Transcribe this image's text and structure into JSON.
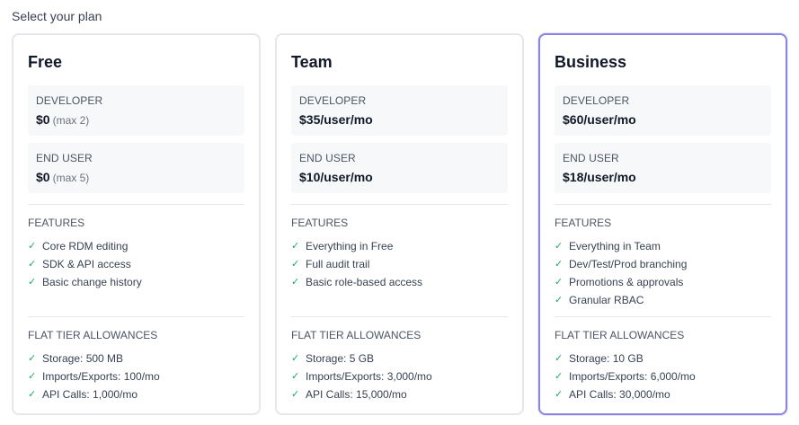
{
  "page": {
    "heading": "Select your plan"
  },
  "plans": [
    {
      "name": "Free",
      "selected": false,
      "developer": {
        "label": "DEVELOPER",
        "price": "$0",
        "note": "(max 2)"
      },
      "end_user": {
        "label": "END USER",
        "price": "$0",
        "note": "(max 5)"
      },
      "features_label": "FEATURES",
      "features": [
        "Core RDM editing",
        "SDK & API access",
        "Basic change history"
      ],
      "allowances_label": "FLAT TIER ALLOWANCES",
      "allowances": [
        "Storage: 500 MB",
        "Imports/Exports: 100/mo",
        "API Calls: 1,000/mo"
      ]
    },
    {
      "name": "Team",
      "selected": false,
      "developer": {
        "label": "DEVELOPER",
        "price": "$35/user/mo",
        "note": ""
      },
      "end_user": {
        "label": "END USER",
        "price": "$10/user/mo",
        "note": ""
      },
      "features_label": "FEATURES",
      "features": [
        "Everything in Free",
        "Full audit trail",
        "Basic role-based access"
      ],
      "allowances_label": "FLAT TIER ALLOWANCES",
      "allowances": [
        "Storage: 5 GB",
        "Imports/Exports: 3,000/mo",
        "API Calls: 15,000/mo"
      ]
    },
    {
      "name": "Business",
      "selected": true,
      "developer": {
        "label": "DEVELOPER",
        "price": "$60/user/mo",
        "note": ""
      },
      "end_user": {
        "label": "END USER",
        "price": "$18/user/mo",
        "note": ""
      },
      "features_label": "FEATURES",
      "features": [
        "Everything in Team",
        "Dev/Test/Prod branching",
        "Promotions & approvals",
        "Granular RBAC"
      ],
      "allowances_label": "FLAT TIER ALLOWANCES",
      "allowances": [
        "Storage: 10 GB",
        "Imports/Exports: 6,000/mo",
        "API Calls: 30,000/mo"
      ]
    }
  ],
  "icons": {
    "check": "check-icon"
  },
  "colors": {
    "accent_border": "#8b84e6",
    "check": "#22a85a",
    "price_bg": "#f7f8fa"
  }
}
